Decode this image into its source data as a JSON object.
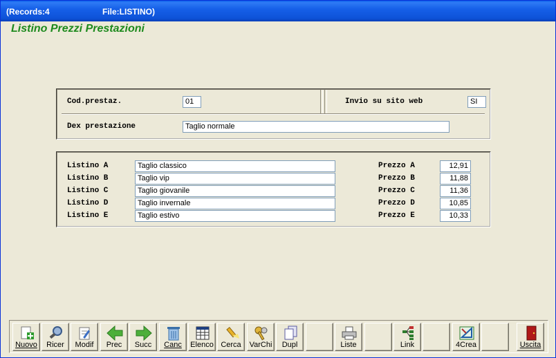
{
  "window": {
    "records": "(Records:4",
    "file": "File:LISTINO)"
  },
  "form": {
    "title": "Listino Prezzi Prestazioni"
  },
  "header_group": {
    "cod_label": "Cod.prestaz.",
    "cod_value": "01",
    "web_label": "Invio su sito web",
    "web_value": "SI",
    "des_label": "Dex prestazione",
    "des_value": "Taglio normale"
  },
  "listini": [
    {
      "label": "Listino A",
      "name": "Taglio classico",
      "price_label": "Prezzo A",
      "price": "12,91"
    },
    {
      "label": "Listino B",
      "name": "Taglio vip",
      "price_label": "Prezzo B",
      "price": "11,88"
    },
    {
      "label": "Listino C",
      "name": "Taglio giovanile",
      "price_label": "Prezzo C",
      "price": "11,36"
    },
    {
      "label": "Listino D",
      "name": "Taglio invernale",
      "price_label": "Prezzo D",
      "price": "10,85"
    },
    {
      "label": "Listino E",
      "name": "Taglio estivo",
      "price_label": "Prezzo E",
      "price": "10,33"
    }
  ],
  "toolbar": {
    "nuovo": "Nuovo",
    "ricer": "Ricer",
    "modif": "Modif",
    "prec": "Prec",
    "succ": "Succ",
    "canc": "Canc",
    "elenco": "Elenco",
    "cerca": "Cerca",
    "varchi": "VarChi",
    "dupl": "Dupl",
    "liste": "Liste",
    "link": "Link",
    "crea": "4Crea",
    "uscita": "Uscita"
  },
  "colors": {
    "title_green": "#1E8A1E",
    "titlebar_blue": "#0D52D8",
    "field_border": "#7F9DB9"
  }
}
